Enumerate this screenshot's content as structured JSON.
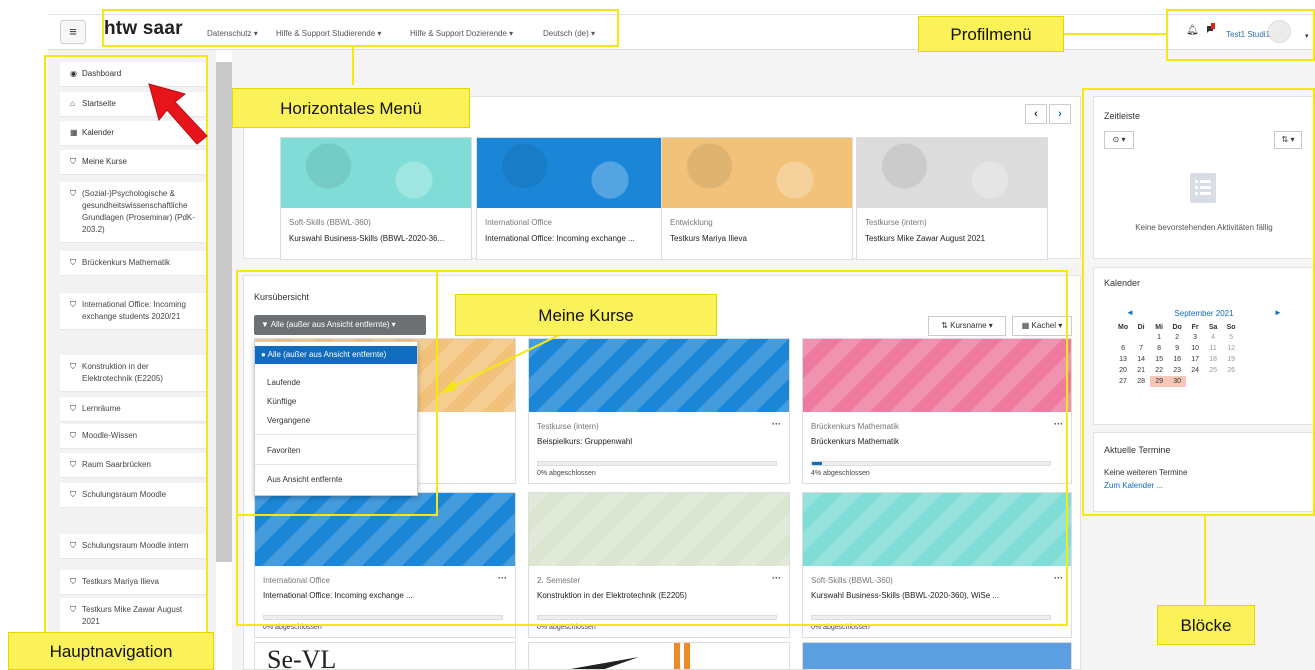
{
  "navbar": {
    "brand": "htw saar",
    "links": [
      "Datenschutz ▾",
      "Hilfe & Support Studierende ▾",
      "Hilfe & Support Dozierende ▾",
      "Deutsch (de) ▾"
    ],
    "user_name": "Test1 Studi1",
    "bell_icon": "bell-icon",
    "message_icon": "message-icon"
  },
  "sidebar": {
    "items": [
      {
        "icon": "dashboard-icon",
        "glyph": "◉",
        "label": "Dashboard"
      },
      {
        "icon": "home-icon",
        "glyph": "⌂",
        "label": "Startseite"
      },
      {
        "icon": "calendar-icon",
        "glyph": "▦",
        "label": "Kalender"
      },
      {
        "icon": "graduation-cap-icon",
        "glyph": "⛉",
        "label": "Meine Kurse"
      },
      {
        "icon": "graduation-cap-icon",
        "glyph": "⛉",
        "label": "(Sozial-)Psychologische & gesundheitswissenschaftliche Grundlagen (Proseminar) (PdK-203.2)"
      },
      {
        "icon": "graduation-cap-icon",
        "glyph": "⛉",
        "label": "Brückenkurs Mathematik"
      },
      {
        "icon": "graduation-cap-icon",
        "glyph": "⛉",
        "label": "International Office: Incoming exchange students 2020/21"
      },
      {
        "icon": "graduation-cap-icon",
        "glyph": "⛉",
        "label": "Konstruktion in der Elektrotechnik (E2205)"
      },
      {
        "icon": "graduation-cap-icon",
        "glyph": "⛉",
        "label": "Lernräume"
      },
      {
        "icon": "graduation-cap-icon",
        "glyph": "⛉",
        "label": "Moodle-Wissen"
      },
      {
        "icon": "graduation-cap-icon",
        "glyph": "⛉",
        "label": "Raum Saarbrücken"
      },
      {
        "icon": "graduation-cap-icon",
        "glyph": "⛉",
        "label": "Schulungsraum Moodle"
      },
      {
        "icon": "graduation-cap-icon",
        "glyph": "⛉",
        "label": "Schulungsraum Moodle intern"
      },
      {
        "icon": "graduation-cap-icon",
        "glyph": "⛉",
        "label": "Testkurs Mariya Ilieva"
      },
      {
        "icon": "graduation-cap-icon",
        "glyph": "⛉",
        "label": "Testkurs Mike Zawar August 2021"
      }
    ]
  },
  "recent": {
    "prev": "‹",
    "next": "›",
    "cards": [
      {
        "category": "Soft-Skills (BBWL-360)",
        "name": "Kurswahl Business-Skills (BBWL-2020-36...",
        "color": "#7fdcd6"
      },
      {
        "category": "International Office",
        "name": "International Office: Incoming exchange ...",
        "color": "#1b86d8"
      },
      {
        "category": "Entwicklung",
        "name": "Testkurs Mariya Ilieva",
        "color": "#f2c27a"
      },
      {
        "category": "Testkurse (intern)",
        "name": "Testkurs Mike Zawar August 2021",
        "color": "#dcdcdc"
      }
    ]
  },
  "overview": {
    "title": "Kursübersicht",
    "filter_label": "▼ Alle (außer aus Ansicht entfernte) ▾",
    "sort_label": "⇅ Kursname ▾",
    "view_label": "▦ Kachel ▾",
    "dropdown": {
      "selected": "● Alle (außer aus Ansicht entfernte)",
      "items": [
        "Laufende",
        "Künftige",
        "Vergangene",
        "Favoriten",
        "Aus Ansicht entfernte"
      ]
    },
    "cards": [
      {
        "category": "",
        "name": "",
        "progress_text": "",
        "progress": null,
        "color": "#f2c27a"
      },
      {
        "category": "Testkurse (intern)",
        "name": "Beispielkurs: Gruppenwahl",
        "progress_text": "0% abgeschlossen",
        "progress": 0,
        "color": "#1b86d8"
      },
      {
        "category": "Brückenkurs Mathematik",
        "name": "Brückenkurs Mathematik",
        "progress_text": "4% abgeschlossen",
        "progress": 0.04,
        "color": "#ef7aa0"
      },
      {
        "category": "International Office",
        "name": "International Office: Incoming exchange ...",
        "progress_text": "0% abgeschlossen",
        "progress": 0,
        "color": "#1b86d8"
      },
      {
        "category": "2. Semester",
        "name": "Konstruktion in der Elektrotechnik (E2205)",
        "progress_text": "0% abgeschlossen",
        "progress": 0,
        "color": "#dbe5d0"
      },
      {
        "category": "Soft-Skills (BBWL-360)",
        "name": "Kurswahl Business-Skills (BBWL-2020-360), WiSe ...",
        "progress_text": "0% abgeschlossen",
        "progress": 0,
        "color": "#7fdcd6"
      }
    ],
    "bottom_text": "Se-VL"
  },
  "blocks": {
    "timeline": {
      "title": "Zeitleiste",
      "filter_btn": "⊙ ▾",
      "sort_btn": "⇅ ▾",
      "empty": "Keine bevorstehenden Aktivitäten fällig"
    },
    "calendar": {
      "title": "Kalender",
      "month": "September 2021",
      "prev": "◄",
      "next": "►",
      "weekdays": [
        "Mo",
        "Di",
        "Mi",
        "Do",
        "Fr",
        "Sa",
        "So"
      ],
      "weeks": [
        [
          "",
          "",
          "1",
          "2",
          "3",
          "4",
          "5"
        ],
        [
          "6",
          "7",
          "8",
          "9",
          "10",
          "11",
          "12"
        ],
        [
          "13",
          "14",
          "15",
          "16",
          "17",
          "18",
          "19"
        ],
        [
          "20",
          "21",
          "22",
          "23",
          "24",
          "25",
          "26"
        ],
        [
          "27",
          "28",
          "29",
          "30",
          "",
          "",
          ""
        ]
      ]
    },
    "events": {
      "title": "Aktuelle Termine",
      "text": "Keine weiteren Termine",
      "link": "Zum Kalender ..."
    }
  },
  "annotations": {
    "horizontal_menu": "Horizontales Menü",
    "profile_menu": "Profilmenü",
    "my_courses": "Meine Kurse",
    "blocks": "Blöcke",
    "main_nav": "Hauptnavigation"
  },
  "colors": {
    "accent": "#0f6cbf",
    "highlight": "#fbf25a",
    "arrow": "#e8141c"
  }
}
